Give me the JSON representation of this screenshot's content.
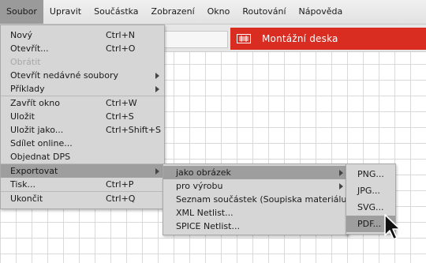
{
  "menubar": {
    "items": [
      "Soubor",
      "Upravit",
      "Součástka",
      "Zobrazení",
      "Okno",
      "Routování",
      "Nápověda"
    ],
    "active": "Soubor"
  },
  "tab": {
    "label": "Montážní deska",
    "color": "#d92d21"
  },
  "file_menu": {
    "items": [
      {
        "label": "Nový",
        "shortcut": "Ctrl+N"
      },
      {
        "label": "Otevřít...",
        "shortcut": "Ctrl+O"
      },
      {
        "label": "Obrátit",
        "shortcut": "",
        "disabled": true
      },
      {
        "label": "Otevřít nedávné soubory",
        "shortcut": "",
        "submenu": true
      },
      {
        "label": "Příklady",
        "shortcut": "",
        "submenu": true
      },
      {
        "label": "Zavřít okno",
        "shortcut": "Ctrl+W"
      },
      {
        "label": "Uložit",
        "shortcut": "Ctrl+S"
      },
      {
        "label": "Uložit jako...",
        "shortcut": "Ctrl+Shift+S"
      },
      {
        "label": "Sdílet online...",
        "shortcut": ""
      },
      {
        "label": "Objednat DPS",
        "shortcut": ""
      },
      {
        "label": "Exportovat",
        "shortcut": "",
        "submenu": true
      },
      {
        "label": "Tisk...",
        "shortcut": "Ctrl+P"
      },
      {
        "label": "Ukončit",
        "shortcut": "Ctrl+Q"
      }
    ]
  },
  "export_menu": {
    "items": [
      {
        "label": "jako obrázek",
        "submenu": true
      },
      {
        "label": "pro výrobu",
        "submenu": true
      },
      {
        "label": "Seznam součástek (Soupiska materiálu)..."
      },
      {
        "label": "XML Netlist..."
      },
      {
        "label": "SPICE Netlist..."
      }
    ]
  },
  "image_menu": {
    "items": [
      "PNG...",
      "JPG...",
      "SVG...",
      "PDF..."
    ]
  }
}
